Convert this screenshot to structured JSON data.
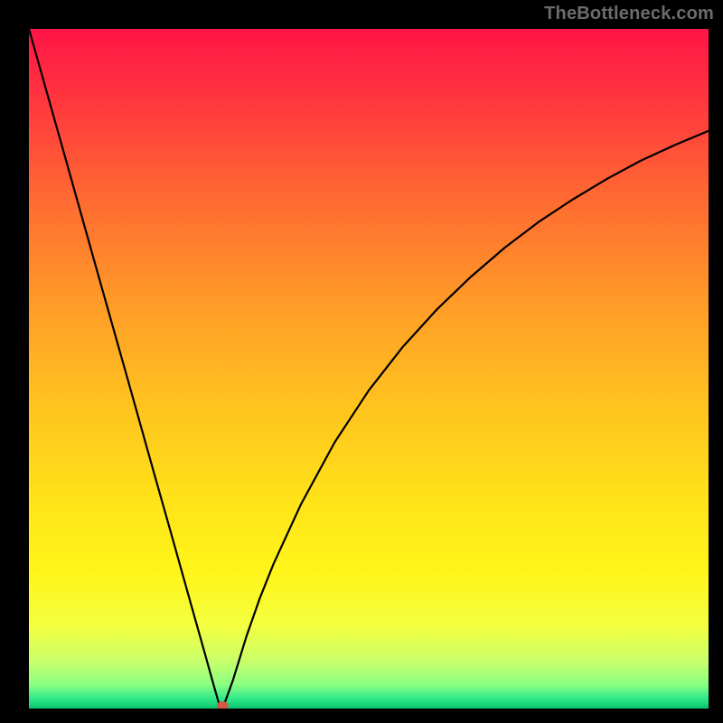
{
  "watermark": "TheBottleneck.com",
  "chart_data": {
    "type": "line",
    "title": "",
    "xlabel": "",
    "ylabel": "",
    "xlim": [
      0,
      100
    ],
    "ylim": [
      0,
      100
    ],
    "series": [
      {
        "name": "curve",
        "x": [
          0,
          5,
          10,
          15,
          18,
          21,
          24,
          26,
          27,
          28,
          28.5,
          30,
          32,
          34,
          36,
          40,
          45,
          50,
          55,
          60,
          65,
          70,
          75,
          80,
          85,
          90,
          95,
          100
        ],
        "values": [
          100,
          82.3,
          64.5,
          46.8,
          36.1,
          25.5,
          14.8,
          7.7,
          4.1,
          0.6,
          0.0,
          4.1,
          10.6,
          16.3,
          21.3,
          30.0,
          39.2,
          46.8,
          53.2,
          58.7,
          63.5,
          67.8,
          71.6,
          74.9,
          77.9,
          80.6,
          82.9,
          85.0
        ]
      }
    ],
    "marker": {
      "x": 28.5,
      "y": 0.0,
      "color": "#d15a46"
    },
    "gradient_stops": [
      {
        "offset": 0.0,
        "color": "#ff1546"
      },
      {
        "offset": 0.12,
        "color": "#ff3b3d"
      },
      {
        "offset": 0.25,
        "color": "#ff6a32"
      },
      {
        "offset": 0.4,
        "color": "#ff9a28"
      },
      {
        "offset": 0.55,
        "color": "#ffc21f"
      },
      {
        "offset": 0.7,
        "color": "#ffe419"
      },
      {
        "offset": 0.8,
        "color": "#fff51a"
      },
      {
        "offset": 0.88,
        "color": "#f3ff41"
      },
      {
        "offset": 0.93,
        "color": "#c9ff6a"
      },
      {
        "offset": 0.965,
        "color": "#8aff82"
      },
      {
        "offset": 0.985,
        "color": "#32e989"
      },
      {
        "offset": 1.0,
        "color": "#07c56e"
      }
    ]
  }
}
